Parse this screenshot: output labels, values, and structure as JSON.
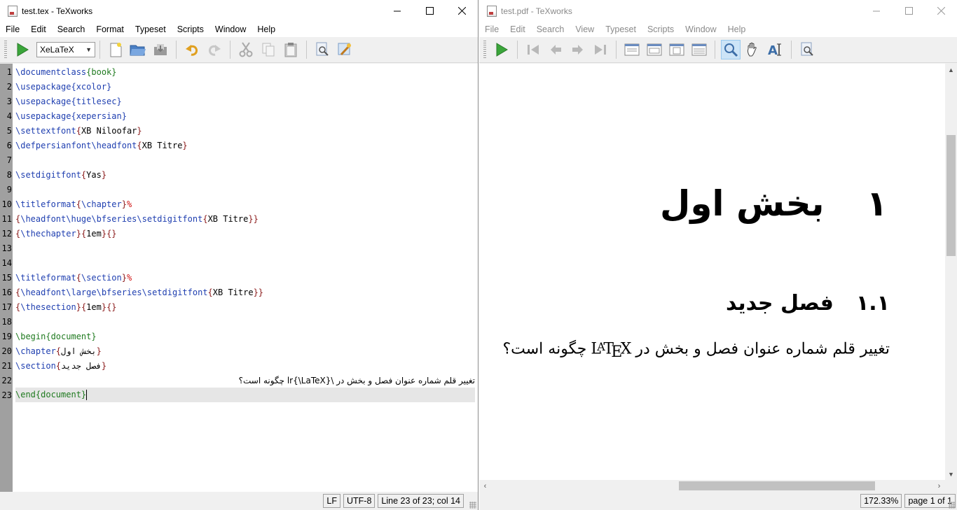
{
  "editor": {
    "title": "test.tex - TeXworks",
    "menu": [
      "File",
      "Edit",
      "Search",
      "Format",
      "Typeset",
      "Scripts",
      "Window",
      "Help"
    ],
    "engine": "XeLaTeX",
    "lines": [
      {
        "n": "1",
        "text": "\\documentclass{book}"
      },
      {
        "n": "2",
        "text": "\\usepackage{xcolor}"
      },
      {
        "n": "3",
        "text": "\\usepackage{titlesec}"
      },
      {
        "n": "4",
        "text": "\\usepackage{xepersian}"
      },
      {
        "n": "5",
        "text": "\\settextfont{XB Niloofar}"
      },
      {
        "n": "6",
        "text": "\\defpersianfont\\headfont{XB Titre}"
      },
      {
        "n": "7",
        "text": ""
      },
      {
        "n": "8",
        "text": "\\setdigitfont{Yas}"
      },
      {
        "n": "9",
        "text": ""
      },
      {
        "n": "10",
        "text": "\\titleformat{\\chapter}%"
      },
      {
        "n": "11",
        "text": "{\\headfont\\huge\\bfseries\\setdigitfont{XB Titre}}"
      },
      {
        "n": "12",
        "text": "{\\thechapter}{1em}{}"
      },
      {
        "n": "13",
        "text": ""
      },
      {
        "n": "14",
        "text": ""
      },
      {
        "n": "15",
        "text": "\\titleformat{\\section}%"
      },
      {
        "n": "16",
        "text": "{\\headfont\\large\\bfseries\\setdigitfont{XB Titre}}"
      },
      {
        "n": "17",
        "text": "{\\thesection}{1em}{}"
      },
      {
        "n": "18",
        "text": ""
      },
      {
        "n": "19",
        "text": "\\begin{document}"
      },
      {
        "n": "20",
        "text": "\\chapter{بخش اول}"
      },
      {
        "n": "21",
        "text": "\\section{فصل جدید}"
      },
      {
        "n": "22",
        "text": "تغییر قلم شماره عنوان فصل و بخش در \\lr{\\LaTeX} چگونه است؟"
      },
      {
        "n": "23",
        "text": "\\end{document}"
      }
    ],
    "status": {
      "line_ending": "LF",
      "encoding": "UTF-8",
      "position": "Line 23 of 23; col 14"
    }
  },
  "pdf": {
    "title": "test.pdf - TeXworks",
    "menu": [
      "File",
      "Edit",
      "Search",
      "View",
      "Typeset",
      "Scripts",
      "Window",
      "Help"
    ],
    "chapter_number": "۱",
    "chapter_title": "بخش اول",
    "section_number": "۱.۱",
    "section_title": "فصل جدید",
    "body_before": "تغییر قلم شماره عنوان فصل و بخش در",
    "body_after": "چگونه است؟",
    "latex_l": "L",
    "latex_a": "A",
    "latex_t": "T",
    "latex_e": "E",
    "latex_x": "X",
    "zoom": "172.33%",
    "page": "page 1 of 1"
  }
}
